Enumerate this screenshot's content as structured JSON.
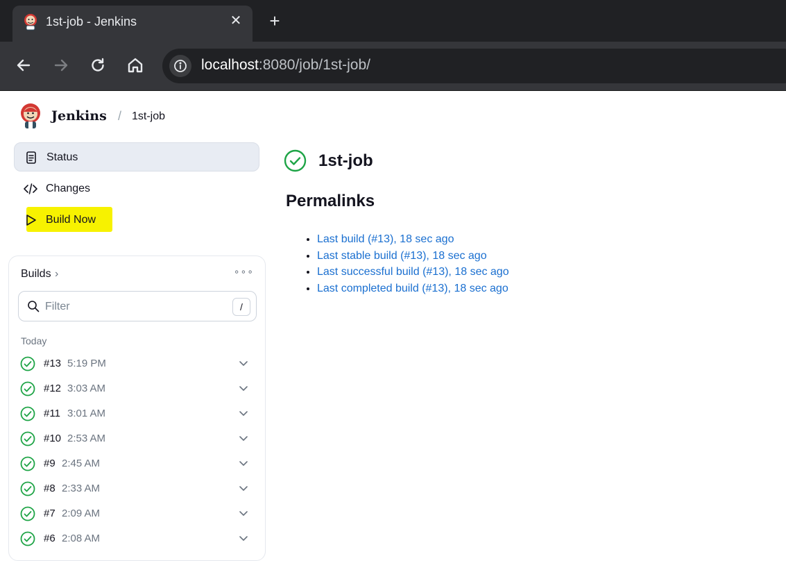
{
  "browser": {
    "tab_title": "1st-job - Jenkins",
    "close_symbol": "✕",
    "new_tab_symbol": "+",
    "url_host": "localhost",
    "url_rest": ":8080/job/1st-job/"
  },
  "header": {
    "brand": "Jenkins",
    "separator": "/",
    "breadcrumb_job": "1st-job"
  },
  "sidebar": {
    "items": [
      {
        "label": "Status",
        "icon": "document-icon"
      },
      {
        "label": "Changes",
        "icon": "code-icon"
      },
      {
        "label": "Build Now",
        "icon": "play-icon"
      }
    ],
    "highlight_color": "#f7f200"
  },
  "builds": {
    "title": "Builds",
    "chevron": "›",
    "more": "∘∘∘",
    "filter_placeholder": "Filter",
    "filter_shortcut": "/",
    "group_label": "Today",
    "rows": [
      {
        "number": "#13",
        "time": "5:19 PM"
      },
      {
        "number": "#12",
        "time": "3:03 AM"
      },
      {
        "number": "#11",
        "time": "3:01 AM"
      },
      {
        "number": "#10",
        "time": "2:53 AM"
      },
      {
        "number": "#9",
        "time": "2:45 AM"
      },
      {
        "number": "#8",
        "time": "2:33 AM"
      },
      {
        "number": "#7",
        "time": "2:09 AM"
      },
      {
        "number": "#6",
        "time": "2:08 AM"
      }
    ]
  },
  "main": {
    "job_title": "1st-job",
    "permalinks_heading": "Permalinks",
    "permalinks": [
      "Last build (#13), 18 sec ago",
      "Last stable build (#13), 18 sec ago",
      "Last successful build (#13), 18 sec ago",
      "Last completed build (#13), 18 sec ago"
    ]
  },
  "colors": {
    "success": "#1ea446",
    "link": "#1a6fd0",
    "chrome_dark": "#202124",
    "chrome_toolbar": "#35363a"
  }
}
